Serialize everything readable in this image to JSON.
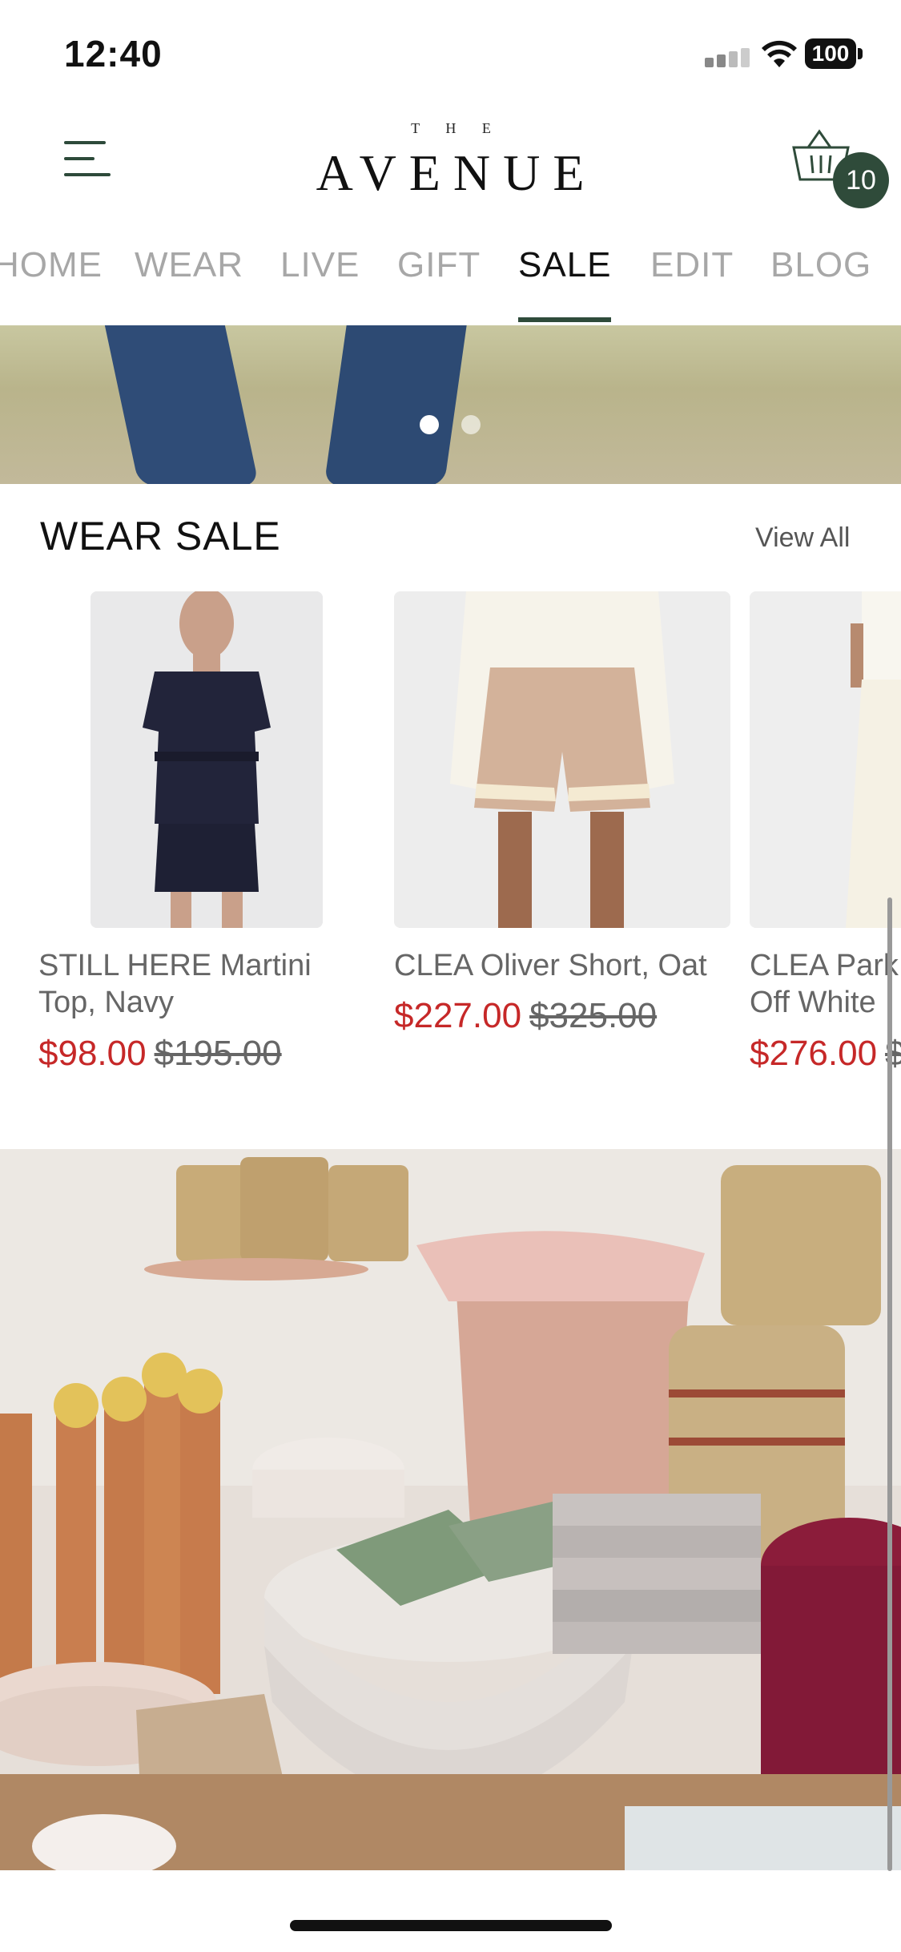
{
  "status_bar": {
    "time": "12:40",
    "battery": "100"
  },
  "header": {
    "logo_small": "T H E",
    "logo_main": "AVENUE",
    "cart_count": "10"
  },
  "tabs": [
    {
      "label": "HOME",
      "active": false
    },
    {
      "label": "WEAR",
      "active": false
    },
    {
      "label": "LIVE",
      "active": false
    },
    {
      "label": "GIFT",
      "active": false
    },
    {
      "label": "SALE",
      "active": true
    },
    {
      "label": "EDIT",
      "active": false
    },
    {
      "label": "BLOG",
      "active": false
    }
  ],
  "hero": {
    "page_count": 2,
    "active_page": 1
  },
  "wear_sale": {
    "title": "WEAR SALE",
    "view_all": "View All",
    "products": [
      {
        "name_line1": "STILL HERE Martini",
        "name_line2": "Top, Navy",
        "sale_price": "$98.00",
        "original_price": "$195.00"
      },
      {
        "name_line1": "CLEA Oliver Short, Oat",
        "name_line2": "",
        "sale_price": "$227.00",
        "original_price": "$325.00"
      },
      {
        "name_line1": "CLEA Park",
        "name_line2": "Off White",
        "sale_price": "$276.00",
        "original_price": "$"
      }
    ]
  },
  "colors": {
    "accent": "#2f4b3a",
    "sale": "#c62828",
    "inactive_tab": "#a7a7a7"
  }
}
